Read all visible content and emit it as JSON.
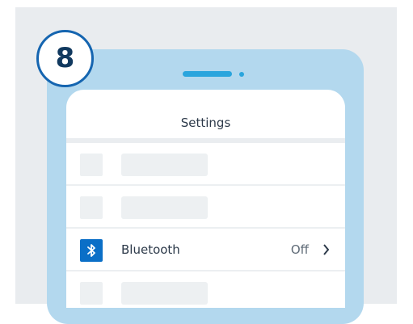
{
  "step": {
    "number": "8"
  },
  "settings": {
    "title": "Settings",
    "bluetooth": {
      "label": "Bluetooth",
      "value": "Off",
      "icon": "bluetooth-icon",
      "icon_color": "#0b6fc7"
    }
  },
  "colors": {
    "panel_background": "#e9ecef",
    "phone_body": "#b3d8ee",
    "speaker_accent": "#2aa5dd",
    "badge_border": "#1565b0",
    "placeholder": "#edf0f2"
  }
}
